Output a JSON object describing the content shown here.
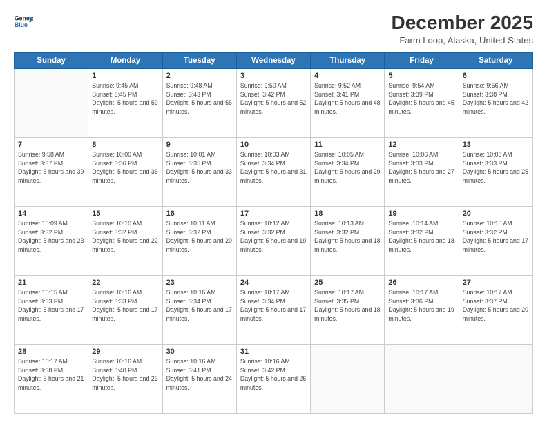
{
  "header": {
    "logo_line1": "General",
    "logo_line2": "Blue",
    "title": "December 2025",
    "subtitle": "Farm Loop, Alaska, United States"
  },
  "days_of_week": [
    "Sunday",
    "Monday",
    "Tuesday",
    "Wednesday",
    "Thursday",
    "Friday",
    "Saturday"
  ],
  "weeks": [
    [
      {
        "day": "",
        "info": ""
      },
      {
        "day": "1",
        "info": "Sunrise: 9:45 AM\nSunset: 3:45 PM\nDaylight: 5 hours\nand 59 minutes."
      },
      {
        "day": "2",
        "info": "Sunrise: 9:48 AM\nSunset: 3:43 PM\nDaylight: 5 hours\nand 55 minutes."
      },
      {
        "day": "3",
        "info": "Sunrise: 9:50 AM\nSunset: 3:42 PM\nDaylight: 5 hours\nand 52 minutes."
      },
      {
        "day": "4",
        "info": "Sunrise: 9:52 AM\nSunset: 3:41 PM\nDaylight: 5 hours\nand 48 minutes."
      },
      {
        "day": "5",
        "info": "Sunrise: 9:54 AM\nSunset: 3:39 PM\nDaylight: 5 hours\nand 45 minutes."
      },
      {
        "day": "6",
        "info": "Sunrise: 9:56 AM\nSunset: 3:38 PM\nDaylight: 5 hours\nand 42 minutes."
      }
    ],
    [
      {
        "day": "7",
        "info": "Sunrise: 9:58 AM\nSunset: 3:37 PM\nDaylight: 5 hours\nand 39 minutes."
      },
      {
        "day": "8",
        "info": "Sunrise: 10:00 AM\nSunset: 3:36 PM\nDaylight: 5 hours\nand 36 minutes."
      },
      {
        "day": "9",
        "info": "Sunrise: 10:01 AM\nSunset: 3:35 PM\nDaylight: 5 hours\nand 33 minutes."
      },
      {
        "day": "10",
        "info": "Sunrise: 10:03 AM\nSunset: 3:34 PM\nDaylight: 5 hours\nand 31 minutes."
      },
      {
        "day": "11",
        "info": "Sunrise: 10:05 AM\nSunset: 3:34 PM\nDaylight: 5 hours\nand 29 minutes."
      },
      {
        "day": "12",
        "info": "Sunrise: 10:06 AM\nSunset: 3:33 PM\nDaylight: 5 hours\nand 27 minutes."
      },
      {
        "day": "13",
        "info": "Sunrise: 10:08 AM\nSunset: 3:33 PM\nDaylight: 5 hours\nand 25 minutes."
      }
    ],
    [
      {
        "day": "14",
        "info": "Sunrise: 10:09 AM\nSunset: 3:32 PM\nDaylight: 5 hours\nand 23 minutes."
      },
      {
        "day": "15",
        "info": "Sunrise: 10:10 AM\nSunset: 3:32 PM\nDaylight: 5 hours\nand 22 minutes."
      },
      {
        "day": "16",
        "info": "Sunrise: 10:11 AM\nSunset: 3:32 PM\nDaylight: 5 hours\nand 20 minutes."
      },
      {
        "day": "17",
        "info": "Sunrise: 10:12 AM\nSunset: 3:32 PM\nDaylight: 5 hours\nand 19 minutes."
      },
      {
        "day": "18",
        "info": "Sunrise: 10:13 AM\nSunset: 3:32 PM\nDaylight: 5 hours\nand 18 minutes."
      },
      {
        "day": "19",
        "info": "Sunrise: 10:14 AM\nSunset: 3:32 PM\nDaylight: 5 hours\nand 18 minutes."
      },
      {
        "day": "20",
        "info": "Sunrise: 10:15 AM\nSunset: 3:32 PM\nDaylight: 5 hours\nand 17 minutes."
      }
    ],
    [
      {
        "day": "21",
        "info": "Sunrise: 10:15 AM\nSunset: 3:33 PM\nDaylight: 5 hours\nand 17 minutes."
      },
      {
        "day": "22",
        "info": "Sunrise: 10:16 AM\nSunset: 3:33 PM\nDaylight: 5 hours\nand 17 minutes."
      },
      {
        "day": "23",
        "info": "Sunrise: 10:16 AM\nSunset: 3:34 PM\nDaylight: 5 hours\nand 17 minutes."
      },
      {
        "day": "24",
        "info": "Sunrise: 10:17 AM\nSunset: 3:34 PM\nDaylight: 5 hours\nand 17 minutes."
      },
      {
        "day": "25",
        "info": "Sunrise: 10:17 AM\nSunset: 3:35 PM\nDaylight: 5 hours\nand 18 minutes."
      },
      {
        "day": "26",
        "info": "Sunrise: 10:17 AM\nSunset: 3:36 PM\nDaylight: 5 hours\nand 19 minutes."
      },
      {
        "day": "27",
        "info": "Sunrise: 10:17 AM\nSunset: 3:37 PM\nDaylight: 5 hours\nand 20 minutes."
      }
    ],
    [
      {
        "day": "28",
        "info": "Sunrise: 10:17 AM\nSunset: 3:38 PM\nDaylight: 5 hours\nand 21 minutes."
      },
      {
        "day": "29",
        "info": "Sunrise: 10:16 AM\nSunset: 3:40 PM\nDaylight: 5 hours\nand 23 minutes."
      },
      {
        "day": "30",
        "info": "Sunrise: 10:16 AM\nSunset: 3:41 PM\nDaylight: 5 hours\nand 24 minutes."
      },
      {
        "day": "31",
        "info": "Sunrise: 10:16 AM\nSunset: 3:42 PM\nDaylight: 5 hours\nand 26 minutes."
      },
      {
        "day": "",
        "info": ""
      },
      {
        "day": "",
        "info": ""
      },
      {
        "day": "",
        "info": ""
      }
    ]
  ]
}
